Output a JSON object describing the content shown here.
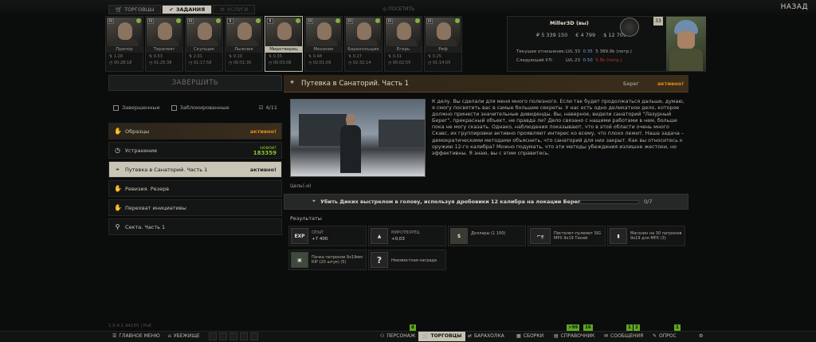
{
  "top": {
    "tabs": [
      {
        "label": "ТОРГОВЦЫ"
      },
      {
        "label": "ЗАДАНИЯ"
      },
      {
        "label": "УСЛУГИ"
      }
    ],
    "pay_label": "ПОСЕТИТЬ",
    "back_label": "НАЗАД"
  },
  "traders": [
    {
      "name": "Прапор",
      "level": "III",
      "m1": "1.28",
      "m2": "00:28:18"
    },
    {
      "name": "Терапевт",
      "level": "III",
      "m1": "0.53",
      "m2": "01:25:38"
    },
    {
      "name": "Скупщик",
      "level": "III",
      "m1": "2.01",
      "m2": "01:17:58"
    },
    {
      "name": "Лыжник",
      "level": "II",
      "m1": "0.10",
      "m2": "00:51:35"
    },
    {
      "name": "Миротворец",
      "level": "II",
      "m1": "0.35",
      "m2": "00:03:08"
    },
    {
      "name": "Механик",
      "level": "III",
      "m1": "0.48",
      "m2": "02:01:09"
    },
    {
      "name": "Барахольщик",
      "level": "III",
      "m1": "0.27",
      "m2": "02:32:14"
    },
    {
      "name": "Егерь",
      "level": "III",
      "m1": "0.31",
      "m2": "00:02:55"
    },
    {
      "name": "Реф",
      "level": "III",
      "m1": "0.25",
      "m2": "01:14:05"
    }
  ],
  "player": {
    "name": "Miller3D (вы)",
    "roubles": "₽ 5 339 150",
    "euros": "€ 4 799",
    "dollars": "$ 12 709",
    "level": "33",
    "standing_label": "Текущее отношение:",
    "next_label": "Следующий УЛ:",
    "cur_lvl": "LVL 33",
    "cur_rep": "0.35",
    "cur_money": "5 389.9k (потр.)",
    "next_lvl": "LVL 23",
    "next_rep": "0.50",
    "next_money": "5.5k (потр.)"
  },
  "left": {
    "finish_label": "ЗАВЕРШИТЬ",
    "filter_completed": "Завершенные",
    "filter_locked": "Заблокированные",
    "filter_count": "4/11",
    "quests": [
      {
        "title": "Образцы",
        "status": "активно!"
      },
      {
        "title": "Устранение",
        "new_label": "новое!",
        "timer": "183359"
      },
      {
        "title": "Путевка в Санаторий. Часть 1",
        "status": "активно!"
      },
      {
        "title": "Ревизия. Резерв"
      },
      {
        "title": "Перехват инициативы"
      },
      {
        "title": "Секта. Часть 1"
      }
    ]
  },
  "quest": {
    "title": "Путевка в Санаторий. Часть 1",
    "location": "Берег",
    "status": "активно!",
    "description": "К делу. Вы сделали для меня много полезного. Если так будет продолжаться дальше, думаю, я смогу посвятить вас в самые большие секреты. У нас есть одно деликатное дело, которое должно принести значительные дивиденды. Вы, наверное, видели санаторий \"Лазурный Берег\", прекрасный объект, не правда ли? Дело связано с нашими работами в нем, больше пока не могу сказать. Однако, наблюдения показывают, что в этой области очень много Скавс, их группировки активно проявляют интерес ко всему, что плохо лежит. Наша задача – демократическими методами объяснить, что санаторий для них закрыт. Как вы относитесь к оружию 12-го калибра? Можно подумать, что эти методы убеждения излишне жестоки, но эффективны. Я знаю, вы с этим справитесь.",
    "goals_label": "Цель(-и)",
    "goal_text": "Убить Диких выстрелом в голову, используя дробовики 12 калибра на локации Берег",
    "goal_progress": 0,
    "goal_count": "0/7",
    "results_label": "Результаты",
    "rewards": [
      {
        "icon": "EXP",
        "line1": "ОПЫТ",
        "line2": "+7 400"
      },
      {
        "icon": "",
        "line1": "МИРОТВОРЕЦ",
        "line2": "+0,03"
      },
      {
        "icon": "",
        "label": "Доллары (1 100)"
      },
      {
        "icon": "",
        "label": "Пистолет-пулемет SIG MPX 9x19 Тихий"
      },
      {
        "icon": "",
        "label": "Магазин на 30 патронов 9x19 для MPX (3)"
      },
      {
        "icon": "",
        "label": "Пачка патронов 9x19мм RIP (20 штук) (5)"
      },
      {
        "icon": "?",
        "label": "Неизвестная награда"
      }
    ]
  },
  "bottom": {
    "version": "1.0.4.1.44155 | PvE",
    "main_menu": "ГЛАВНОЕ МЕНЮ",
    "hideout": "УБЕЖИЩЕ",
    "character": "ПЕРСОНАЖ",
    "traders": "ТОРГОВЦЫ",
    "flea": "БАРАХОЛКА",
    "builds": "СБОРКИ",
    "handbook": "СПРАВОЧНИК",
    "messages": "СООБЩЕНИЯ",
    "survey": "ОПРОС",
    "badge_character": "8",
    "badge_handbook": ">99",
    "badge_handbook2": "16",
    "badge_messages": "1",
    "badge_messages2": "2",
    "badge_survey": "1"
  },
  "colors": {
    "accent_orange": "#e08b18",
    "new_green": "#87c32c",
    "selected_bg": "#c9c5b6"
  }
}
